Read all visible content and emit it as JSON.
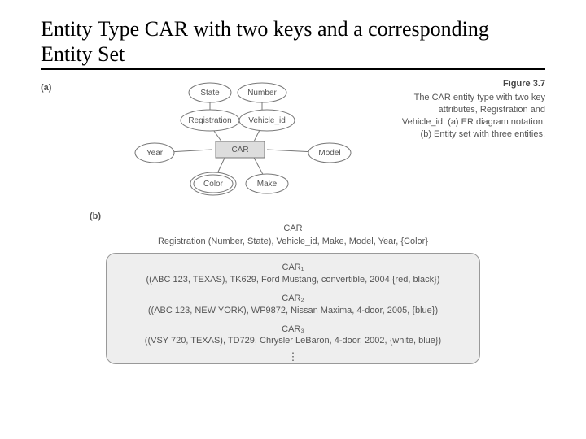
{
  "title": "Entity Type CAR with two keys and a corresponding Entity Set",
  "labels": {
    "a": "(a)",
    "b": "(b)"
  },
  "caption": {
    "fignum": "Figure 3.7",
    "text": "The CAR entity type with two key attributes, Registration and Vehicle_id. (a) ER diagram notation. (b) Entity set with three entities."
  },
  "diagram": {
    "entity": "CAR",
    "attrs": {
      "state": "State",
      "number": "Number",
      "registration": "Registration",
      "vehicle_id": "Vehicle_id",
      "year": "Year",
      "model": "Model",
      "color": "Color",
      "make": "Make"
    }
  },
  "schema": {
    "name": "CAR",
    "line": "Registration (Number, State), Vehicle_id, Make, Model, Year, {Color}"
  },
  "entities": [
    {
      "name": "CAR₁",
      "tuple": "((ABC 123, TEXAS), TK629, Ford Mustang, convertible, 2004 {red, black})"
    },
    {
      "name": "CAR₂",
      "tuple": "((ABC 123, NEW YORK), WP9872, Nissan Maxima, 4-door, 2005, {blue})"
    },
    {
      "name": "CAR₃",
      "tuple": "((VSY 720, TEXAS), TD729, Chrysler LeBaron, 4-door, 2002, {white, blue})"
    }
  ],
  "dots": "⋮"
}
